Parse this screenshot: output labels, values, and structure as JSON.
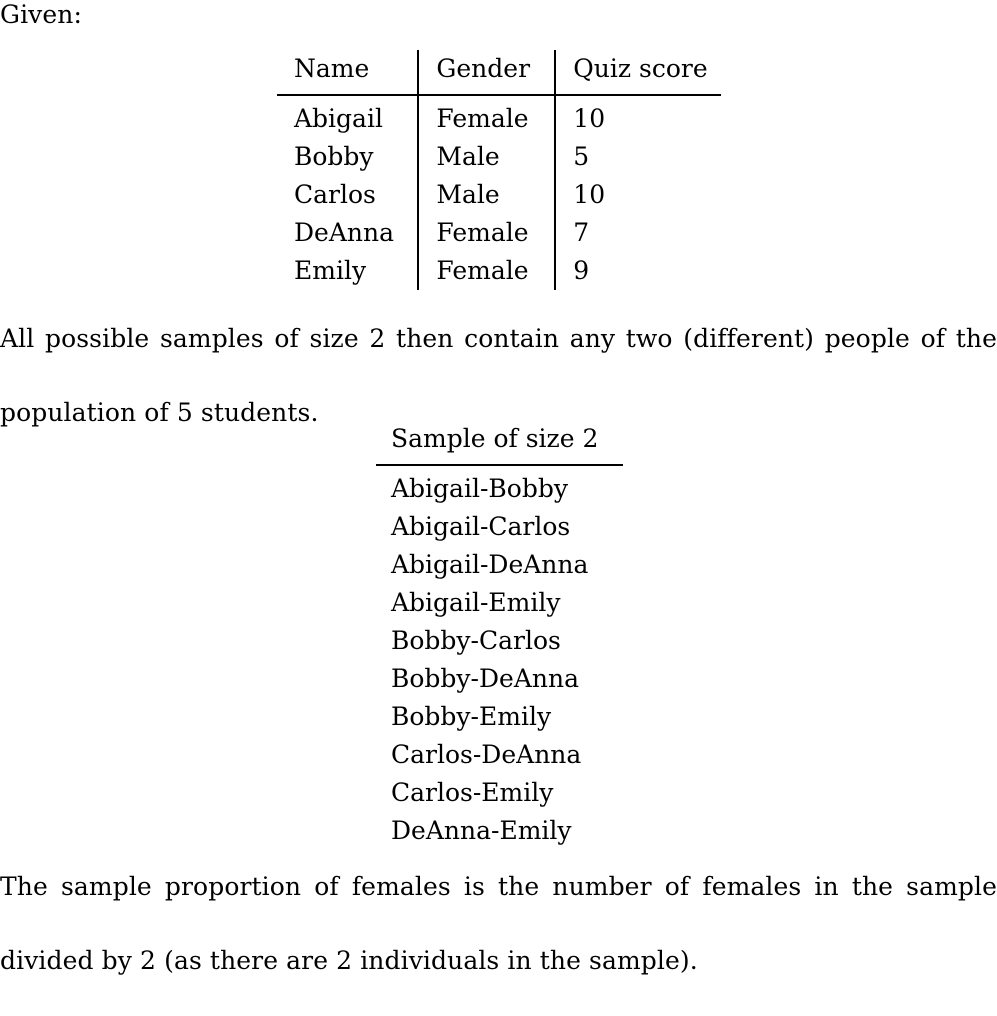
{
  "document": {
    "intro_label": "Given:",
    "student_table": {
      "columns": [
        "Name",
        "Gender",
        "Quiz score"
      ],
      "rows": [
        {
          "name": "Abigail",
          "gender": "Female",
          "score": "10"
        },
        {
          "name": "Bobby",
          "gender": "Male",
          "score": "5"
        },
        {
          "name": "Carlos",
          "gender": "Male",
          "score": "10"
        },
        {
          "name": "DeAnna",
          "gender": "Female",
          "score": "7"
        },
        {
          "name": "Emily",
          "gender": "Female",
          "score": "9"
        }
      ]
    },
    "paragraph_samples": {
      "line1": "All possible samples of size 2 then contain any two (different) people of the",
      "line2": "population of 5 students."
    },
    "samples_table": {
      "header": "Sample of size 2",
      "rows": [
        "Abigail-Bobby",
        "Abigail-Carlos",
        "Abigail-DeAnna",
        "Abigail-Emily",
        "Bobby-Carlos",
        "Bobby-DeAnna",
        "Bobby-Emily",
        "Carlos-DeAnna",
        "Carlos-Emily",
        "DeAnna-Emily"
      ]
    },
    "paragraph_proportion": {
      "line1": "The sample proportion of females is the number of females in the sample",
      "line2": "divided by 2 (as there are 2 individuals in the sample)."
    }
  }
}
